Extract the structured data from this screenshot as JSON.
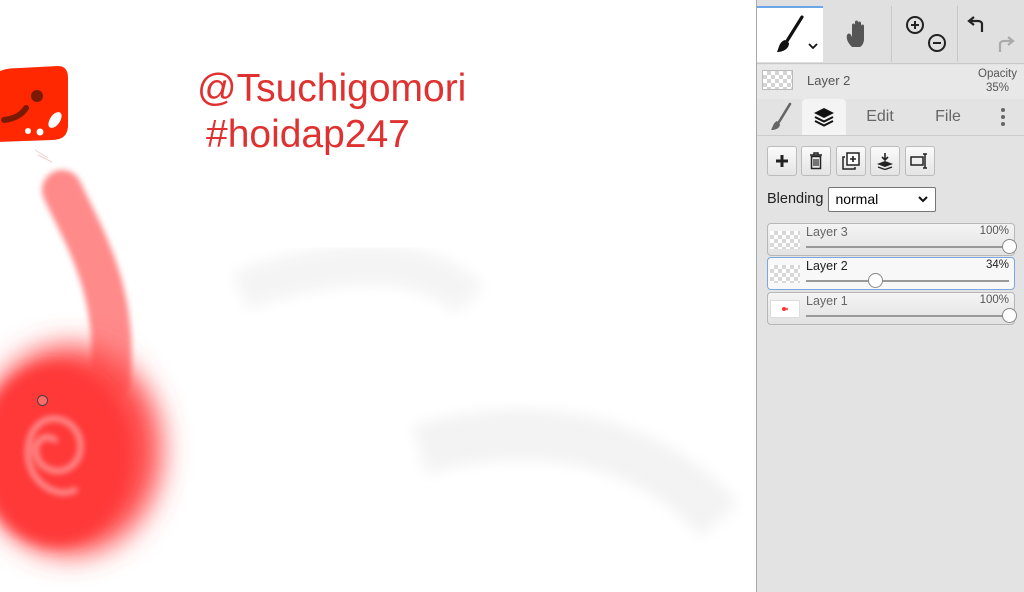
{
  "canvas": {
    "handle_text": "@Tsuchigomori",
    "hashtag_text": "#hoidap247"
  },
  "toolbar": {
    "brush_icon": "brush-icon",
    "hand_icon": "hand-icon",
    "zoom_in_icon": "zoom-in-icon",
    "zoom_out_icon": "zoom-out-icon",
    "undo_icon": "undo-icon",
    "redo_icon": "redo-icon"
  },
  "active_layer": {
    "name": "Layer 2",
    "opacity_label": "Opacity",
    "opacity_value": "35%"
  },
  "tabs": {
    "edit": "Edit",
    "file": "File"
  },
  "layer_tools": [
    "add-layer",
    "delete-layer",
    "duplicate-layer",
    "merge-down",
    "transform"
  ],
  "blending": {
    "label": "Blending",
    "value": "normal"
  },
  "layers": [
    {
      "name": "Layer 3",
      "opacity": "100%",
      "level": 1.0,
      "selected": false
    },
    {
      "name": "Layer 2",
      "opacity": "34%",
      "level": 0.34,
      "selected": true
    },
    {
      "name": "Layer 1",
      "opacity": "100%",
      "level": 1.0,
      "selected": false
    }
  ],
  "colors": {
    "accent_blue": "#6aa6e8",
    "paint_red": "#ff3b3b",
    "text_red": "#e03131"
  }
}
